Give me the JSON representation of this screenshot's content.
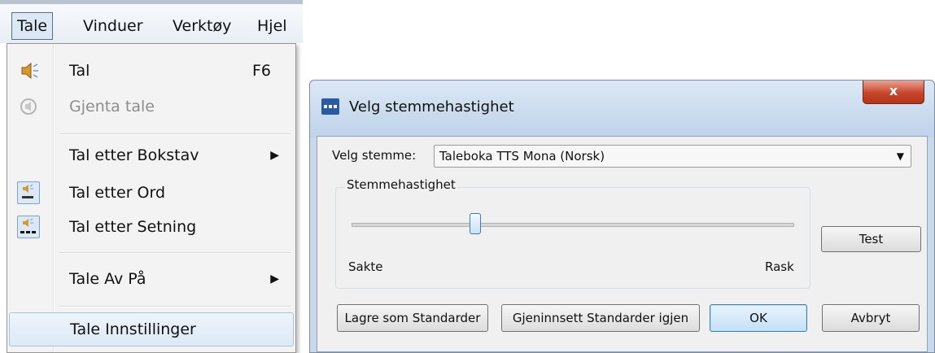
{
  "menubar": {
    "items": [
      {
        "label": "Tale",
        "active": true
      },
      {
        "label": "Vinduer"
      },
      {
        "label": "Verktøy"
      },
      {
        "label": "Hjel"
      }
    ]
  },
  "menu": {
    "items": [
      {
        "label": "Tal",
        "shortcut": "F6",
        "icon": "speaker-icon"
      },
      {
        "label": "Gjenta tale",
        "disabled": true,
        "icon": "repeat-speech-icon"
      },
      {
        "label": "Tal etter Bokstav",
        "submenu": true
      },
      {
        "label": "Tal etter Ord",
        "icon": "speak-word-icon"
      },
      {
        "label": "Tal etter Setning",
        "icon": "speak-sentence-icon"
      },
      {
        "label": "Tale Av På",
        "submenu": true
      },
      {
        "label": "Tale Innstillinger",
        "highlighted": true
      }
    ]
  },
  "dialog": {
    "title": "Velg stemmehastighet",
    "close_label": "x",
    "voice_label": "Velg stemme:",
    "voice_value": "Taleboka TTS Mona (Norsk)",
    "group_title": "Stemmehastighet",
    "slow_label": "Sakte",
    "fast_label": "Rask",
    "speed_fraction": 0.28,
    "buttons": {
      "test": "Test",
      "save_default": "Lagre som Standarder",
      "restore_default": "Gjeninnsett Standarder igjen",
      "ok": "OK",
      "cancel": "Avbryt"
    }
  },
  "colors": {
    "accent": "#3c7fb1",
    "close": "#c8452b"
  }
}
